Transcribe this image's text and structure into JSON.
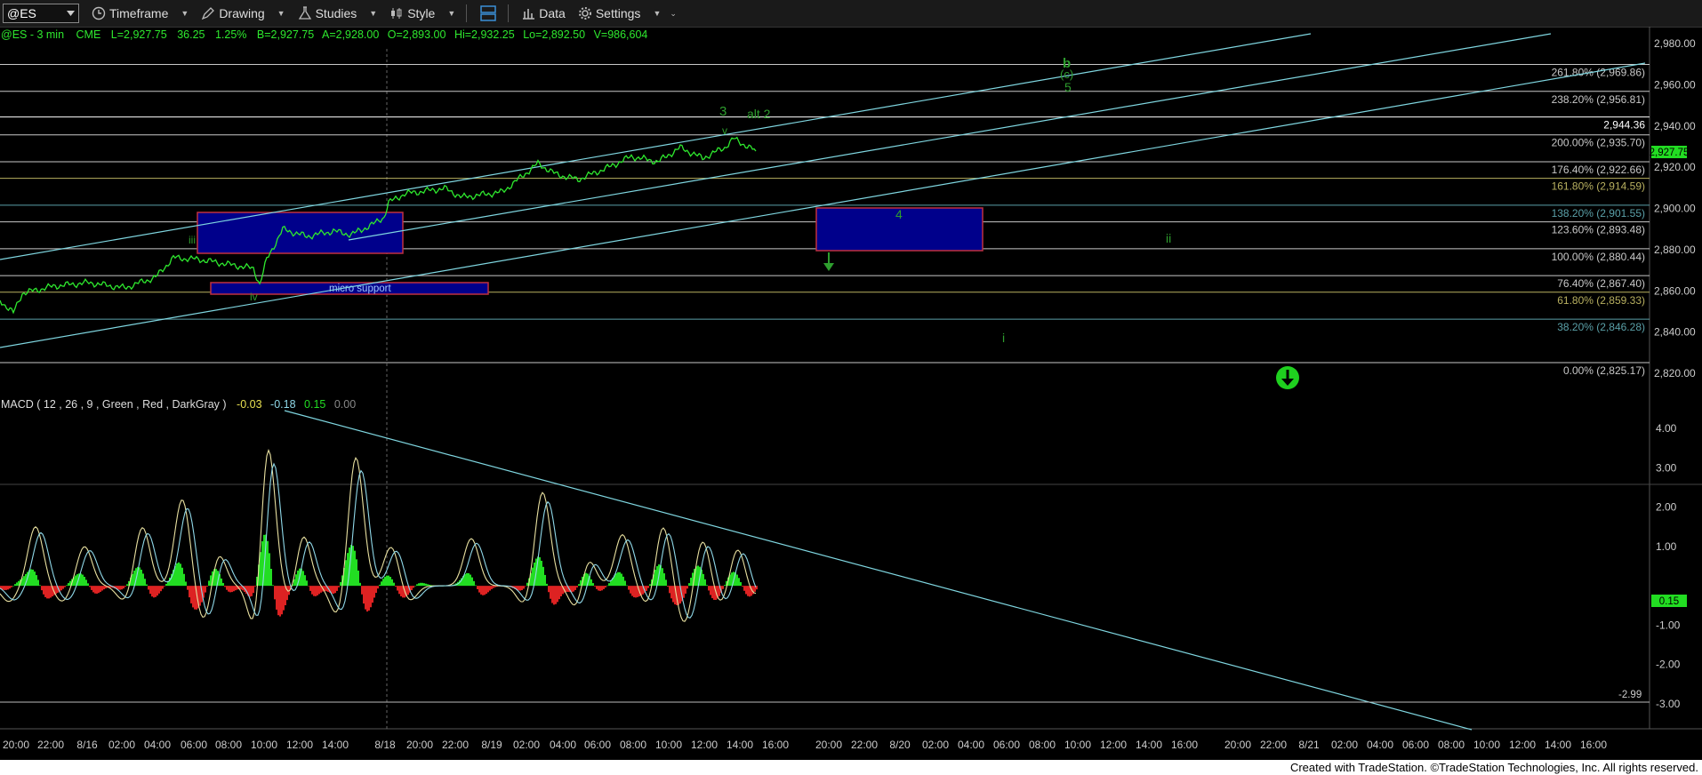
{
  "toolbar": {
    "symbol": "@ES",
    "timeframe": "Timeframe",
    "drawing": "Drawing",
    "studies": "Studies",
    "style": "Style",
    "data": "Data",
    "settings": "Settings"
  },
  "header": {
    "symbol_info": "@ES - 3 min",
    "exchange": "CME",
    "last": "L=2,927.75",
    "change": "36.25",
    "change_pct": "1.25%",
    "bid": "B=2,927.75",
    "ask": "A=2,928.00",
    "open": "O=2,893.00",
    "high": "Hi=2,932.25",
    "low": "Lo=2,892.50",
    "volume": "V=986,604"
  },
  "price_axis": {
    "ticks": [
      "2,980.00",
      "2,960.00",
      "2,940.00",
      "2,920.00",
      "2,900.00",
      "2,880.00",
      "2,860.00",
      "2,840.00",
      "2,820.00"
    ],
    "current_price": "2,927.75"
  },
  "fib_levels": [
    {
      "label": "261.80% (2,969.86)",
      "price": 2969.86,
      "color": "#c8c8c8"
    },
    {
      "label": "238.20% (2,956.81)",
      "price": 2956.81,
      "color": "#c8c8c8"
    },
    {
      "label": "2,944.36",
      "price": 2944.36,
      "color": "#ffffff"
    },
    {
      "label": "200.00% (2,935.70)",
      "price": 2935.7,
      "color": "#c8c8c8"
    },
    {
      "label": "176.40% (2,922.66)",
      "price": 2922.66,
      "color": "#c8c8c8"
    },
    {
      "label": "161.80% (2,914.59)",
      "price": 2914.59,
      "color": "#b8b060"
    },
    {
      "label": "138.20% (2,901.55)",
      "price": 2901.55,
      "color": "#5aa0a8"
    },
    {
      "label": "123.60% (2,893.48)",
      "price": 2893.48,
      "color": "#c8c8c8"
    },
    {
      "label": "100.00% (2,880.44)",
      "price": 2880.44,
      "color": "#c8c8c8"
    },
    {
      "label": "76.40% (2,867.40)",
      "price": 2867.4,
      "color": "#c8c8c8"
    },
    {
      "label": "61.80% (2,859.33)",
      "price": 2859.33,
      "color": "#b8b060"
    },
    {
      "label": "38.20% (2,846.28)",
      "price": 2846.28,
      "color": "#5aa0a8"
    },
    {
      "label": "0.00% (2,825.17)",
      "price": 2825.17,
      "color": "#c8c8c8"
    }
  ],
  "wave_labels": {
    "b": "b",
    "c": "(c)",
    "five": "5",
    "three": "3",
    "alt2": "alt 2",
    "v": "v",
    "four": "4",
    "ii_right": "ii",
    "i_right": "i",
    "iii": "iii",
    "iv": "iv",
    "micro_support": "micro support"
  },
  "macd": {
    "title": "MACD ( 12 , 26 , 9 , Green , Red , DarkGray )",
    "v1": "-0.03",
    "v2": "-0.18",
    "v3": "0.15",
    "v4": "0.00",
    "ticks": [
      "4.00",
      "3.00",
      "2.00",
      "1.00",
      "-1.00",
      "-2.00",
      "-3.00"
    ],
    "current": "0.15",
    "low_label": "-2.99"
  },
  "time_axis": [
    "20:00",
    "22:00",
    "8/16",
    "02:00",
    "04:00",
    "06:00",
    "08:00",
    "10:00",
    "12:00",
    "14:00",
    "8/18",
    "20:00",
    "22:00",
    "8/19",
    "02:00",
    "04:00",
    "06:00",
    "08:00",
    "10:00",
    "12:00",
    "14:00",
    "16:00",
    "20:00",
    "22:00",
    "8/20",
    "02:00",
    "04:00",
    "06:00",
    "08:00",
    "10:00",
    "12:00",
    "14:00",
    "16:00",
    "20:00",
    "22:00",
    "8/21",
    "02:00",
    "04:00",
    "06:00",
    "08:00",
    "10:00",
    "12:00",
    "14:00",
    "16:00"
  ],
  "footer": "Created with TradeStation. ©TradeStation Technologies, Inc. All rights reserved.",
  "colors": {
    "price": "#2ee82e",
    "fib_line": "#9fc8d0",
    "trend": "#7fd6e0",
    "box_fill": "#00008b",
    "box_border": "#c03040",
    "wave_green": "#2e9e2e",
    "macd_pos": "#22dd22",
    "macd_neg": "#dd2222"
  }
}
